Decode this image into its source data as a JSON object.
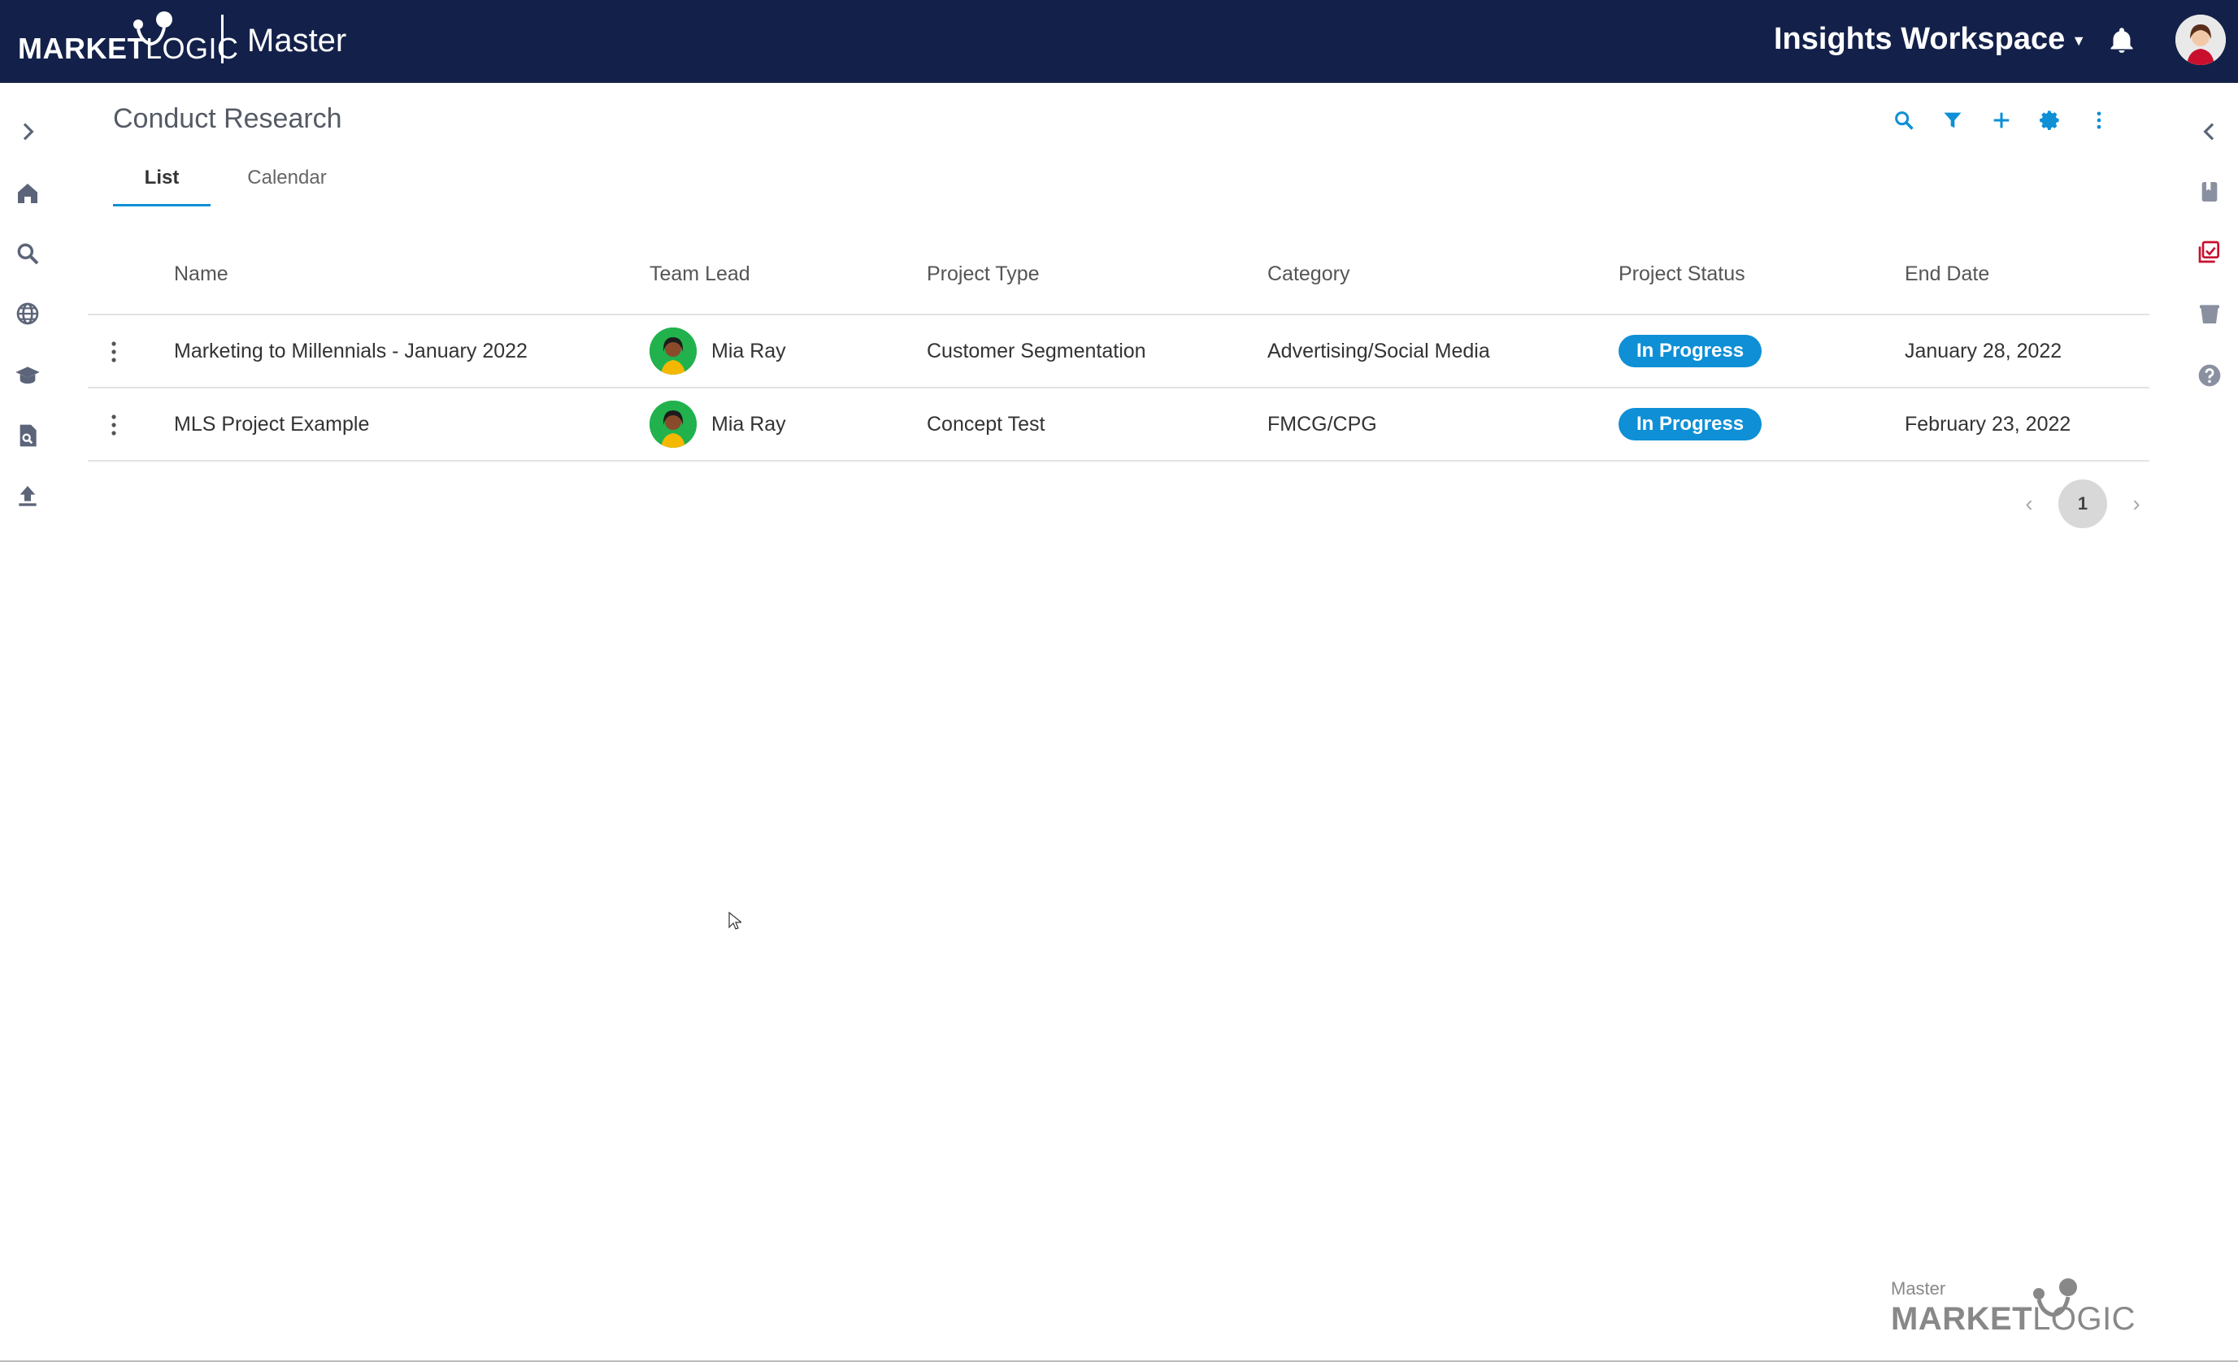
{
  "topbar": {
    "logo_bold": "MARKET",
    "logo_light": "LOGIC",
    "app_name": "Master",
    "workspace": "Insights Workspace",
    "workspace_caret_icon": "caret-down-icon",
    "notification_icon": "bell-icon",
    "avatar_icon": "user-avatar"
  },
  "left_rail": {
    "items": [
      {
        "name": "expand-chevron-icon"
      },
      {
        "name": "home-icon"
      },
      {
        "name": "search-icon"
      },
      {
        "name": "globe-icon"
      },
      {
        "name": "graduation-cap-icon"
      },
      {
        "name": "document-search-icon"
      },
      {
        "name": "upload-icon"
      }
    ]
  },
  "right_rail": {
    "items": [
      {
        "name": "collapse-chevron-icon"
      },
      {
        "name": "bookmark-icon"
      },
      {
        "name": "checklist-icon"
      },
      {
        "name": "basket-icon"
      },
      {
        "name": "help-icon"
      }
    ]
  },
  "page": {
    "title": "Conduct Research",
    "tabs": [
      {
        "label": "List",
        "active": true
      },
      {
        "label": "Calendar",
        "active": false
      }
    ],
    "toolbar": [
      "search-icon",
      "filter-icon",
      "plus-icon",
      "gear-icon",
      "more-vertical-icon"
    ]
  },
  "table": {
    "columns": [
      "Name",
      "Team Lead",
      "Project Type",
      "Category",
      "Project Status",
      "End Date"
    ],
    "rows": [
      {
        "name": "Marketing to Millennials - January 2022",
        "team_lead": "Mia Ray",
        "project_type": "Customer Segmentation",
        "category": "Advertising/Social Media",
        "status": "In Progress",
        "end_date": "January 28, 2022"
      },
      {
        "name": "MLS Project Example",
        "team_lead": "Mia Ray",
        "project_type": "Concept Test",
        "category": "FMCG/CPG",
        "status": "In Progress",
        "end_date": "February 23, 2022"
      }
    ]
  },
  "pagination": {
    "current_page": "1",
    "prev_icon": "chevron-left-icon",
    "next_icon": "chevron-right-icon"
  },
  "footer": {
    "small": "Master",
    "logo_bold": "MARKET",
    "logo_light": "LOGIC"
  },
  "colors": {
    "topbar": "#13214a",
    "accent": "#0e8fd6",
    "lead_avatar": "#21b24d"
  }
}
